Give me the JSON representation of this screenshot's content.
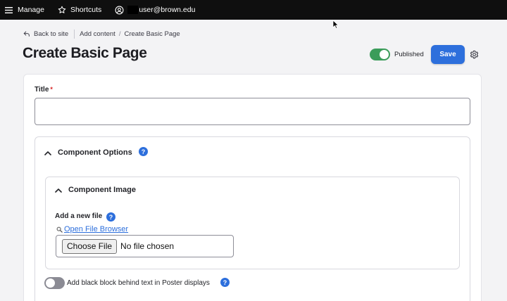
{
  "toolbar": {
    "manage_label": "Manage",
    "shortcuts_label": "Shortcuts",
    "user_label": "user@brown.edu"
  },
  "breadcrumb": {
    "back_label": "Back to site",
    "items": [
      "Add content",
      "Create Basic Page"
    ]
  },
  "header": {
    "title": "Create Basic Page",
    "published_label": "Published",
    "published": true,
    "save_label": "Save"
  },
  "form": {
    "title_label": "Title",
    "title_required_mark": "*",
    "title_value": "",
    "component_options": {
      "summary": "Component Options",
      "help": "?",
      "component_image": {
        "summary": "Component Image",
        "add_file_label": "Add a new file",
        "help": "?",
        "open_browser_label": "Open File Browser",
        "choose_button_label": "Choose File",
        "no_file_text": "No file chosen"
      },
      "black_block": {
        "label": "Add black block behind text in Poster displays",
        "enabled": false,
        "help": "?"
      }
    }
  },
  "colors": {
    "toolbar_bg": "#0f0f0f",
    "primary": "#2d6fdc",
    "toggle_on": "#3b9c5a",
    "toggle_off": "#8b8b94",
    "required": "#d72222"
  }
}
